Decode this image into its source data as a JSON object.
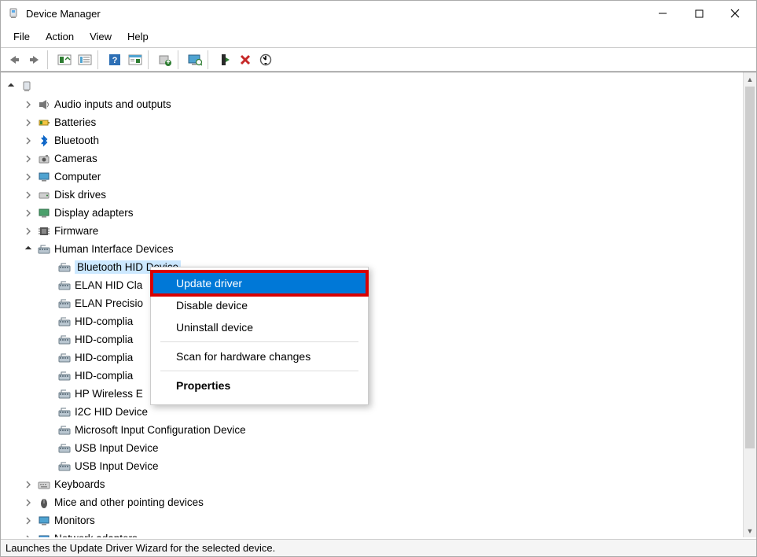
{
  "window": {
    "title": "Device Manager"
  },
  "menus": [
    "File",
    "Action",
    "View",
    "Help"
  ],
  "toolbar": {
    "items": [
      {
        "id": "back",
        "name": "back-icon"
      },
      {
        "id": "forward",
        "name": "forward-icon"
      },
      {
        "sep": true
      },
      {
        "id": "show-hidden",
        "name": "show-hidden-icon"
      },
      {
        "id": "refresh-page",
        "name": "refresh-page-icon"
      },
      {
        "sep": true
      },
      {
        "id": "help",
        "name": "help-icon"
      },
      {
        "id": "props-sheet",
        "name": "properties-page-icon"
      },
      {
        "sep": true
      },
      {
        "id": "update-driver",
        "name": "update-driver-icon"
      },
      {
        "sep": true
      },
      {
        "id": "monitor",
        "name": "monitor-icon"
      },
      {
        "sep": true
      },
      {
        "id": "enable",
        "name": "enable-device-icon"
      },
      {
        "id": "uninstall",
        "name": "uninstall-device-icon"
      },
      {
        "id": "scan",
        "name": "scan-hardware-icon"
      }
    ]
  },
  "tree": {
    "root": {
      "label": "",
      "expanded": true
    },
    "items": [
      {
        "label": "Audio inputs and outputs",
        "icon": "audio",
        "exp": ">"
      },
      {
        "label": "Batteries",
        "icon": "battery",
        "exp": ">"
      },
      {
        "label": "Bluetooth",
        "icon": "bluetooth",
        "exp": ">"
      },
      {
        "label": "Cameras",
        "icon": "camera",
        "exp": ">"
      },
      {
        "label": "Computer",
        "icon": "computer",
        "exp": ">"
      },
      {
        "label": "Disk drives",
        "icon": "disk",
        "exp": ">"
      },
      {
        "label": "Display adapters",
        "icon": "display",
        "exp": ">"
      },
      {
        "label": "Firmware",
        "icon": "firmware",
        "exp": ">"
      },
      {
        "label": "Human Interface Devices",
        "icon": "hid",
        "exp": "v",
        "children": [
          {
            "label": "Bluetooth HID Device",
            "icon": "hid"
          },
          {
            "label": "ELAN HID Cla",
            "icon": "hid"
          },
          {
            "label": "ELAN Precisio",
            "icon": "hid"
          },
          {
            "label": "HID-complia",
            "icon": "hid"
          },
          {
            "label": "HID-complia",
            "icon": "hid"
          },
          {
            "label": "HID-complia",
            "icon": "hid"
          },
          {
            "label": "HID-complia",
            "icon": "hid"
          },
          {
            "label": "HP Wireless E",
            "icon": "hid"
          },
          {
            "label": "I2C HID Device",
            "icon": "hid"
          },
          {
            "label": "Microsoft Input Configuration Device",
            "icon": "hid"
          },
          {
            "label": "USB Input Device",
            "icon": "hid"
          },
          {
            "label": "USB Input Device",
            "icon": "hid"
          }
        ]
      },
      {
        "label": "Keyboards",
        "icon": "keyboard",
        "exp": ">"
      },
      {
        "label": "Mice and other pointing devices",
        "icon": "mouse",
        "exp": ">"
      },
      {
        "label": "Monitors",
        "icon": "monitor",
        "exp": ">"
      },
      {
        "label": "Network adapters",
        "icon": "network",
        "exp": ">"
      }
    ]
  },
  "context_menu": {
    "items": [
      {
        "label": "Update driver",
        "highlight": true
      },
      {
        "label": "Disable device"
      },
      {
        "label": "Uninstall device"
      },
      {
        "sep": true
      },
      {
        "label": "Scan for hardware changes"
      },
      {
        "sep": true
      },
      {
        "label": "Properties",
        "bold": true
      }
    ]
  },
  "status": "Launches the Update Driver Wizard for the selected device."
}
